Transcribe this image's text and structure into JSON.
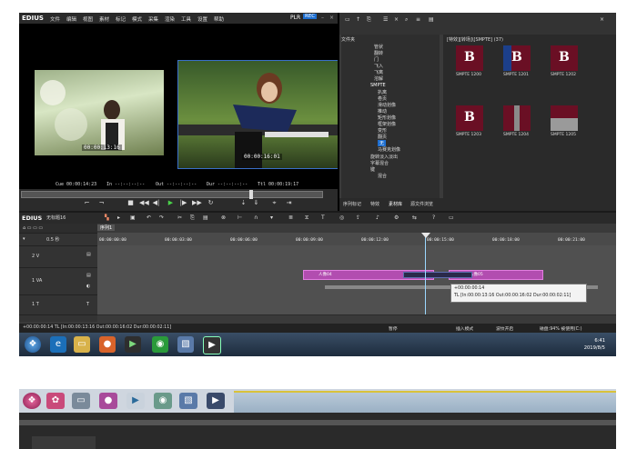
{
  "app": {
    "logo": "EDIUS",
    "menu": [
      "文件",
      "编辑",
      "视图",
      "素材",
      "标记",
      "模式",
      "采集",
      "渲染",
      "工具",
      "设置",
      "帮助"
    ],
    "plr": "PLR",
    "rec": "REC"
  },
  "monitor": {
    "left_tc": "00:00:13:16",
    "right_tc": "00:00:16:01",
    "cue": "Cue 00:00:14:23",
    "in": "In --:--:--:--",
    "out": "Out --:--:--:--",
    "dur": "Dur --:--:--:--",
    "ttl": "Ttl 00:00:19:17"
  },
  "bin": {
    "tree_header": "文件夹",
    "grid_header": "[特效][转场]\\[SMPTE] (37)",
    "tree_items": [
      "管状",
      "翻转",
      "门",
      "飞入",
      "飞离",
      "溶解",
      "SMPTE",
      "扒离",
      "卷页",
      "滑动划像",
      "推动",
      "矩形划像",
      "框架划像",
      "变形",
      "翻页",
      "无",
      "马赛克划像",
      "旋转淡入淡出",
      "字幕混合",
      "键",
      "混合"
    ],
    "thumbs": [
      {
        "label": "SMPTE 1200"
      },
      {
        "label": "SMPTE 1201"
      },
      {
        "label": "SMPTE 1202"
      },
      {
        "label": "SMPTE 1203"
      },
      {
        "label": "SMPTE 1204"
      },
      {
        "label": "SMPTE 1205"
      }
    ],
    "tabs": [
      "序列标记",
      "特效",
      "素材库",
      "源文件浏览"
    ],
    "accent": "#6a0f24"
  },
  "timeline": {
    "logo": "EDIUS",
    "project": "无标题16",
    "sequence_tab": "序列1",
    "ruler_labels": [
      "00:00:00:00",
      "00:00:03:00",
      "00:00:06:00",
      "00:00:09:00",
      "00:00:12:00",
      "00:00:15:00",
      "00:00:18:00",
      "00:00:21:00"
    ],
    "zoom": "0.5 秒",
    "tracks": [
      {
        "name": "2 V"
      },
      {
        "name": "1 VA"
      },
      {
        "name": "1 T"
      }
    ],
    "clips": [
      "人像04",
      "人像05"
    ],
    "tooltip_line1": "+00:00:00:14",
    "tooltip_line2": "TL [In:00:00:13:16 Out:00:00:16:02 Dur:00:00:02:11]"
  },
  "status": {
    "left": "+00:00:00:14 TL [In:00:00:13:16 Out:00:00:16:02 Dur:00:00:02:11]",
    "pause": "暂停",
    "insert": "插入模式",
    "ripple": "波纹开启",
    "disk": "磁盘:94% 被使用(C:)"
  },
  "taskbar": {
    "time": "6:41",
    "date": "2019/8/5"
  }
}
